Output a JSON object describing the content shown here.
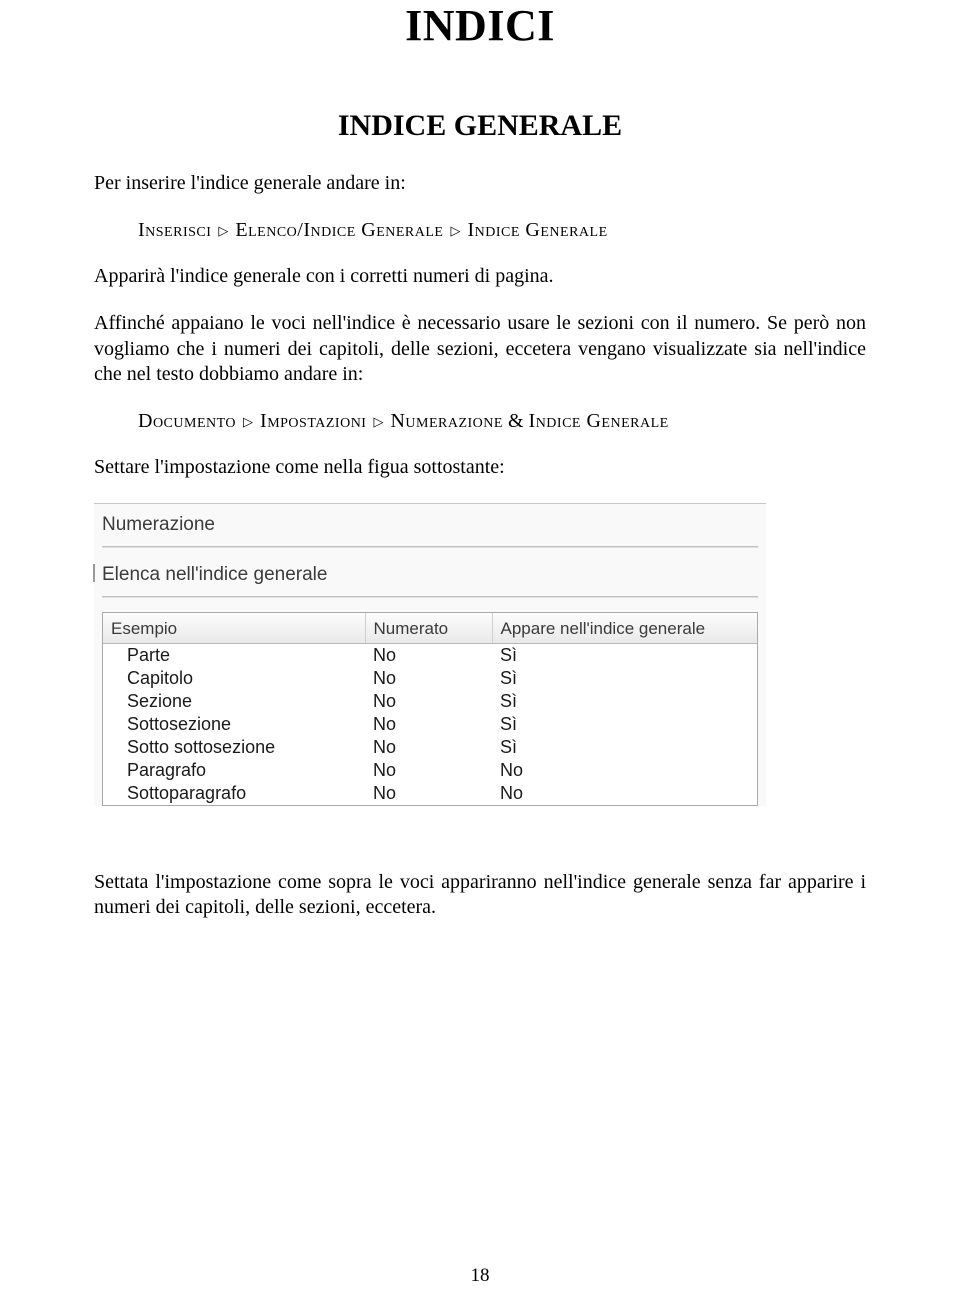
{
  "title": "INDICI",
  "section_title": "INDICE GENERALE",
  "intro": "Per inserire l'indice generale andare in:",
  "menu1": {
    "a": "Inserisci",
    "b": "Elenco/Indice Generale",
    "c": "Indice Generale"
  },
  "para1": "Apparirà l'indice generale con i corretti numeri di pagina.",
  "para2": "Affinché appaiano le voci nell'indice è necessario usare le sezioni con il numero. Se però non vogliamo che i numeri dei capitoli, delle sezioni, eccetera vengano visualizzate sia nell'indice che nel testo dobbiamo andare in:",
  "menu2": {
    "a": "Documento",
    "b": "Impostazioni",
    "c": "Numerazione",
    "amp": "&",
    "d": "Indice Generale"
  },
  "para3": "Settare l'impostazione come nella figua sottostante:",
  "panel": {
    "label1": "Numerazione",
    "label2": "Elenca nell'indice generale",
    "headers": {
      "ex": "Esempio",
      "num": "Numerato",
      "app": "Appare nell'indice generale"
    },
    "rows": [
      {
        "ex": "Parte",
        "num": "No",
        "app": "Sì"
      },
      {
        "ex": "Capitolo",
        "num": "No",
        "app": "Sì"
      },
      {
        "ex": "Sezione",
        "num": "No",
        "app": "Sì"
      },
      {
        "ex": "Sottosezione",
        "num": "No",
        "app": "Sì"
      },
      {
        "ex": "Sotto sottosezione",
        "num": "No",
        "app": "Sì"
      },
      {
        "ex": "Paragrafo",
        "num": "No",
        "app": "No"
      },
      {
        "ex": "Sottoparagrafo",
        "num": "No",
        "app": "No"
      }
    ]
  },
  "para4": "Settata l'impostazione come sopra le voci appariranno nell'indice generale senza far apparire i numeri dei capitoli, delle sezioni, eccetera.",
  "page_number": "18",
  "glyphs": {
    "tri": "▷"
  }
}
